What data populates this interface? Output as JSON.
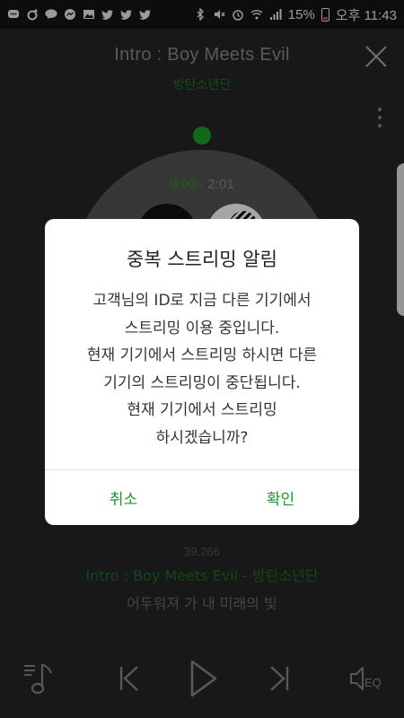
{
  "status_bar": {
    "battery": "15%",
    "time": "오후 11:43",
    "left_icons": [
      "chat-icon",
      "circle-icon",
      "talk-icon",
      "messenger-icon",
      "image-icon",
      "twitter-icon",
      "twitter-icon",
      "twitter-icon"
    ],
    "right_icons": [
      "bluetooth-icon",
      "mute-icon",
      "alarm-icon",
      "wifi-icon",
      "signal-icon",
      "battery-icon"
    ]
  },
  "player": {
    "title": "Intro : Boy Meets Evil",
    "artist": "방탄소년단",
    "time_current": "0:00",
    "time_separator": "·",
    "time_total": "2:01",
    "likes": "39,266",
    "lyric_current": "Intro : Boy Meets Evil - 방탄소년단",
    "lyric_next": "어두워져 가 내 미래의 빛",
    "accent_color": "#1c9e2a",
    "background_color": "#262626"
  },
  "controls": {
    "playlist": "playlist-icon",
    "prev": "previous-icon",
    "play": "play-icon",
    "next": "next-icon",
    "eq_label": "EQ"
  },
  "dialog": {
    "title": "중복 스트리밍 알림",
    "body_lines": [
      "고객님의 ID로 지금 다른 기기에서",
      "스트리밍 이용 중입니다.",
      "현재 기기에서 스트리밍 하시면 다른",
      "기기의 스트리밍이 중단됩니다.",
      "현재 기기에서 스트리밍",
      "하시겠습니까?"
    ],
    "cancel_label": "취소",
    "confirm_label": "확인",
    "button_color": "#1a9a30"
  }
}
